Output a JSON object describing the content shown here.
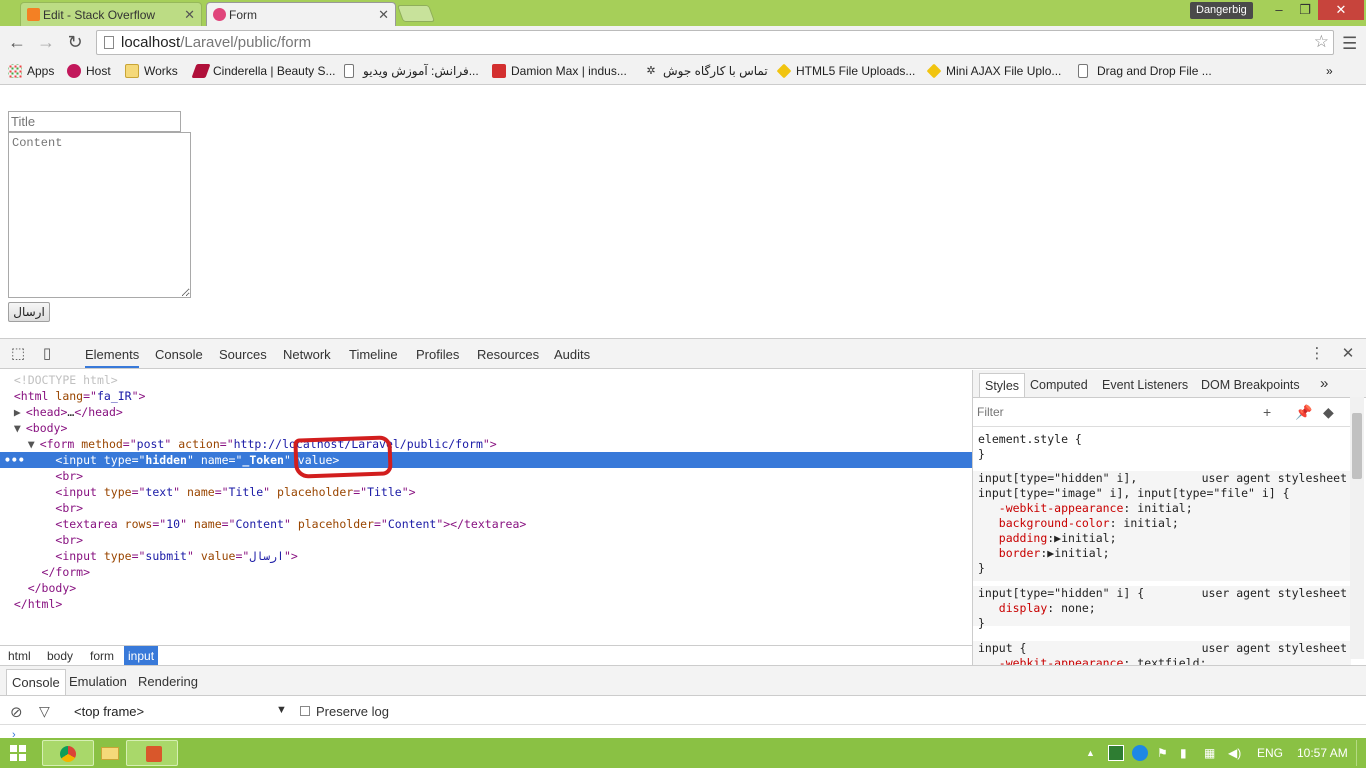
{
  "browser": {
    "tabs": [
      {
        "label": "Edit - Stack Overflow",
        "active": false
      },
      {
        "label": "Form",
        "active": true
      }
    ],
    "profile": "Dangerbig",
    "url_host": "localhost",
    "url_path": "/Laravel/public/form",
    "bookmarks": [
      "Apps",
      "Host",
      "Works",
      "Cinderella | Beauty S...",
      "فرانش: آموزش ویدیو...",
      "Damion Max | indus...",
      "تماس با کارگاه جوش",
      "HTML5 File Uploads...",
      "Mini AJAX File Uplo...",
      "Drag and Drop File ..."
    ],
    "bookmarks_more": "»"
  },
  "page": {
    "title_placeholder": "Title",
    "content_placeholder": "Content",
    "submit_label": "ارسال"
  },
  "devtools": {
    "tabs": [
      "Elements",
      "Console",
      "Sources",
      "Network",
      "Timeline",
      "Profiles",
      "Resources",
      "Audits"
    ],
    "active_tab": "Elements",
    "dom": {
      "doctype": "<!DOCTYPE html>",
      "html_lang": "fa_IR",
      "form_method": "post",
      "form_action": "http://localhost/Laravel/public/form",
      "hidden_name": "_Token",
      "text_name": "Title",
      "text_placeholder": "Title",
      "textarea_rows": "10",
      "textarea_name": "Content",
      "textarea_placeholder": "Content",
      "submit_value": "ارسال"
    },
    "breadcrumbs": [
      "html",
      "body",
      "form",
      "input"
    ],
    "styles_tabs": [
      "Styles",
      "Computed",
      "Event Listeners",
      "DOM Breakpoints"
    ],
    "filter_placeholder": "Filter",
    "styles": {
      "element_style": "element.style {",
      "ua_label": "user agent stylesheet",
      "rule1_sel_a": "input[type=\"hidden\" i],",
      "rule1_sel_b": "input[type=\"image\" i], input[type=\"file\" i] {",
      "rule1_props": [
        {
          "name": "-webkit-appearance",
          "value": "initial;"
        },
        {
          "name": "background-color",
          "value": "initial;"
        },
        {
          "name": "padding",
          "value": "initial;"
        },
        {
          "name": "border",
          "value": "initial;"
        }
      ],
      "rule2_sel": "input[type=\"hidden\" i] {",
      "rule2_prop": "display",
      "rule2_val": "none;",
      "rule3_sel": "input {",
      "rule3_prop": "-webkit-appearance",
      "rule3_val": "textfield;"
    },
    "drawer_tabs": [
      "Console",
      "Emulation",
      "Rendering"
    ],
    "frame": "<top frame>",
    "preserve_log": "Preserve log"
  },
  "taskbar": {
    "language": "ENG",
    "time": "10:57 AM"
  },
  "colors": {
    "titlebar": "#a6cf59",
    "selection": "#3879d9",
    "annotation": "#d21e1e",
    "taskbar": "#8ac144"
  }
}
